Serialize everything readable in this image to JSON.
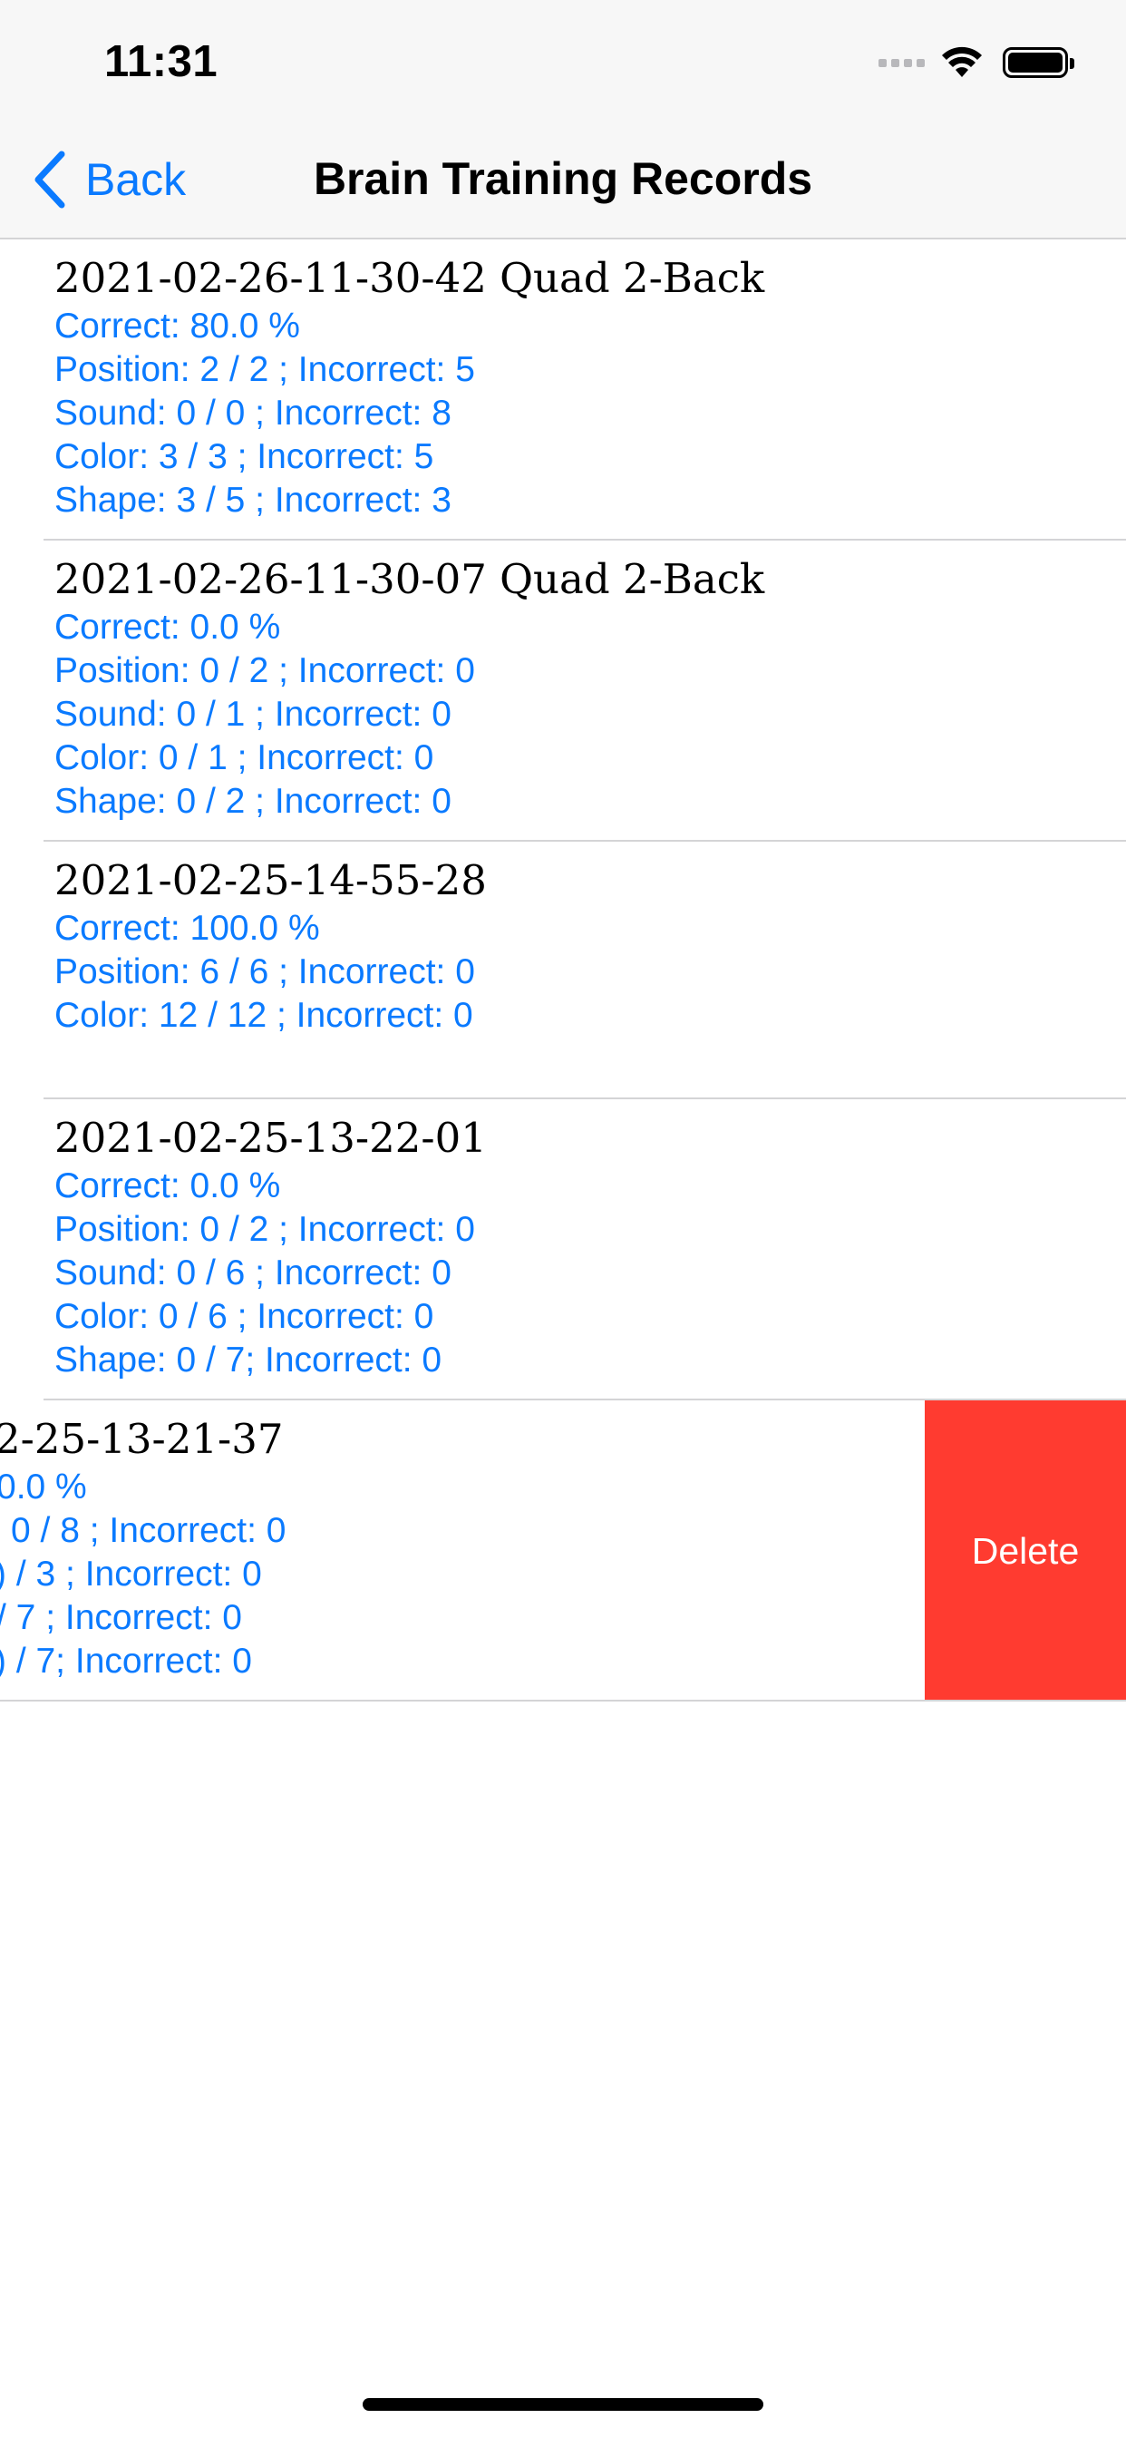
{
  "status_bar": {
    "time": "11:31"
  },
  "nav": {
    "back_label": "Back",
    "title": "Brain Training Records"
  },
  "records": [
    {
      "title": "2021-02-26-11-30-42 Quad 2-Back",
      "lines": [
        "Correct: 80.0 %",
        "Position: 2 / 2 ; Incorrect: 5",
        "Sound: 0 / 0 ; Incorrect: 8",
        "Color: 3 / 3 ; Incorrect: 5",
        "Shape: 3 / 5 ; Incorrect: 3"
      ]
    },
    {
      "title": "2021-02-26-11-30-07 Quad 2-Back",
      "lines": [
        "Correct: 0.0 %",
        "Position: 0 / 2 ; Incorrect: 0",
        "Sound: 0 / 1 ; Incorrect: 0",
        "Color: 0 / 1 ; Incorrect: 0",
        "Shape: 0 / 2 ; Incorrect: 0"
      ]
    },
    {
      "title": "2021-02-25-14-55-28",
      "lines": [
        "Correct: 100.0 %",
        "Position: 6 / 6 ; Incorrect: 0",
        "Color: 12 / 12 ; Incorrect: 0"
      ]
    },
    {
      "title": "2021-02-25-13-22-01",
      "lines": [
        "Correct: 0.0 %",
        "Position: 0 / 2 ; Incorrect: 0",
        "Sound: 0 / 6 ; Incorrect: 0",
        "Color: 0 / 6 ; Incorrect: 0",
        "Shape: 0 / 7; Incorrect: 0"
      ]
    },
    {
      "title": "2-25-13-21-37",
      "lines": [
        "0.0 %",
        "0 / 8 ; Incorrect: 0",
        ") / 3 ; Incorrect: 0",
        "/ 7 ; Incorrect: 0",
        ") / 7; Incorrect: 0"
      ],
      "swiped": true,
      "delete_label": "Delete"
    }
  ],
  "colors": {
    "accent": "#0a7aff",
    "delete": "#ff3b30",
    "separator": "#d4d4d6",
    "nav_bg": "#f7f7f7"
  }
}
